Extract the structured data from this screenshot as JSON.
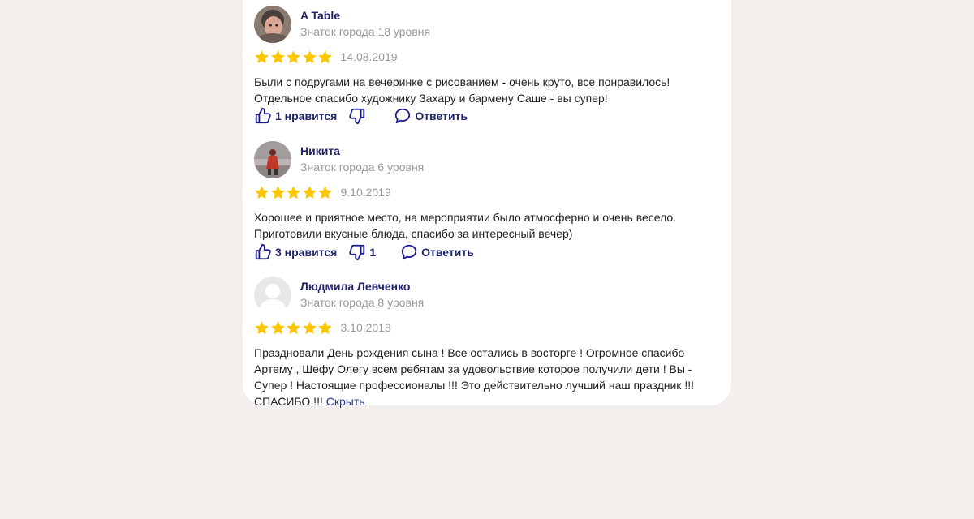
{
  "colors": {
    "page_background": "#f2efec",
    "card_background": "#ffffff",
    "author_name": "#22226b",
    "muted_text": "#999999",
    "star": "#fcc600",
    "action_icon": "#1a1a8f",
    "link": "#2b3a8d"
  },
  "reviews": [
    {
      "author": "A Table",
      "level": "Знаток города 18 уровня",
      "rating": 5,
      "date": "14.08.2019",
      "text": "Были с подругами на вечеринке с рисованием - очень круто, все понравилось! Отдельное спасибо художнику Захару и бармену Саше - вы супер!",
      "likes_label": "1 нравится",
      "dislikes_count": "",
      "reply_label": "Ответить",
      "avatar_icon": "user-photo"
    },
    {
      "author": "Никита",
      "level": "Знаток города 6 уровня",
      "rating": 5,
      "date": "9.10.2019",
      "text": "Хорошее и приятное место, на мероприятии было атмосферно и очень весело. Приготовили вкусные блюда, спасибо за интересный вечер)",
      "likes_label": "3 нравится",
      "dislikes_count": "1",
      "reply_label": "Ответить",
      "avatar_icon": "user-photo"
    },
    {
      "author": "Людмила Левченко",
      "level": "Знаток города 8 уровня",
      "rating": 5,
      "date": "3.10.2018",
      "text": "Праздновали День рождения сына ! Все остались в восторге ! Огромное спасибо Артему , Шефу Олегу всем ребятам за удовольствие которое получили дети ! Вы - Супер ! Настоящие профессионалы !!! Это действительно лучший наш праздник !!! СПАСИБО !!!",
      "hide_label": "Скрыть",
      "avatar_icon": "default-avatar-icon"
    }
  ]
}
